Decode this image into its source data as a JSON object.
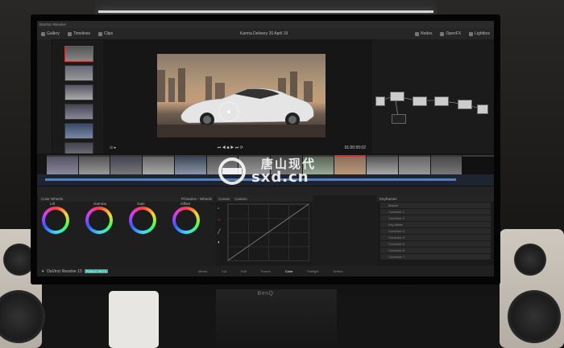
{
  "app": {
    "window_title": "DaVinci Resolve",
    "project_title": "Karma Delivery 20 April 19",
    "top_tabs": [
      "Gallery",
      "Timelines",
      "Clips"
    ],
    "top_right_tabs": [
      "Nodes",
      "OpenFX",
      "Lightbox"
    ],
    "timecode": "01:00:55:02",
    "user_label": "DaVinci Resolve 15",
    "version_badge": "PUBLIC BETA"
  },
  "color_wheels": {
    "header": "Color Wheels",
    "mode_label": "Primaries - Wheels",
    "wheels": [
      "Lift",
      "Gamma",
      "Gain",
      "Offset"
    ]
  },
  "curves": {
    "header": "Curves",
    "mode_label": "Custom"
  },
  "keyframes": {
    "header": "Keyframes",
    "rows": [
      "Master",
      "Corrector 1",
      "Corrector 2",
      "Key Mixer",
      "Corrector 3",
      "Corrector 4",
      "Corrector 5",
      "Corrector 6",
      "Corrector 7"
    ]
  },
  "pages": [
    "Media",
    "Cut",
    "Edit",
    "Fusion",
    "Color",
    "Fairlight",
    "Deliver"
  ],
  "active_page": "Color",
  "monitor": {
    "brand": "BenQ"
  },
  "watermark": {
    "cn": "唐山现代",
    "url": "sxd.cn"
  },
  "colors": {
    "teal_accent": "#27b5a5",
    "timeline_blue": "#5b7fb0"
  }
}
